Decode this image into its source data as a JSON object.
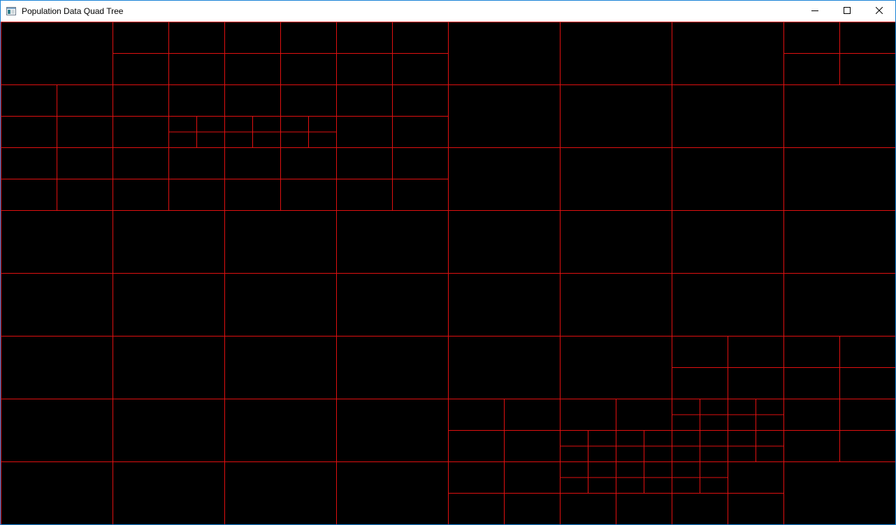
{
  "window": {
    "title": "Population Data Quad Tree",
    "icons": {
      "app": "app-window-icon",
      "minimize": "minimize-icon",
      "maximize": "maximize-icon",
      "close": "close-icon"
    }
  },
  "canvas": {
    "background": "#000000",
    "line_color": "#e01010"
  }
}
